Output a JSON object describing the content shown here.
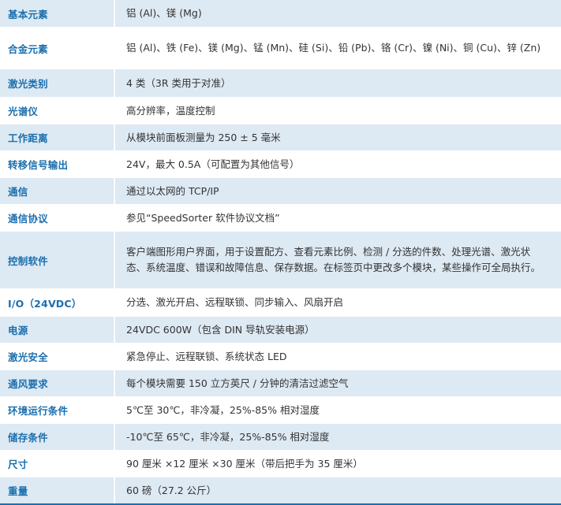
{
  "specs": [
    {
      "label": "基本元素",
      "value": "铝 (Al)、镁 (Mg)"
    },
    {
      "label": "合金元素",
      "value": "铝 (Al)、铁 (Fe)、镁 (Mg)、锰 (Mn)、硅 (Si)、铅 (Pb)、铬 (Cr)、镍 (Ni)、铜 (Cu)、锌 (Zn)"
    },
    {
      "label": "激光类别",
      "value": "4 类（3R 类用于对准）"
    },
    {
      "label": "光谱仪",
      "value": "高分辨率，温度控制"
    },
    {
      "label": "工作距离",
      "value": "从模块前面板测量为 250 ± 5 毫米"
    },
    {
      "label": "转移信号输出",
      "value": "24V，最大 0.5A（可配置为其他信号）"
    },
    {
      "label": "通信",
      "value": "通过以太网的 TCP/IP"
    },
    {
      "label": "通信协议",
      "value": "参见“SpeedSorter 软件协议文档”"
    },
    {
      "label": "控制软件",
      "value": "客户端图形用户界面，用于设置配方、查看元素比例、检测 / 分选的件数、处理光谱、激光状态、系统温度、错误和故障信息、保存数据。在标签页中更改多个模块，某些操作可全局执行。"
    },
    {
      "label": "I/O（24VDC）",
      "value": "分选、激光开启、远程联锁、同步输入、风扇开启"
    },
    {
      "label": "电源",
      "value": "24VDC 600W（包含 DIN 导轨安装电源）"
    },
    {
      "label": "激光安全",
      "value": "紧急停止、远程联锁、系统状态 LED"
    },
    {
      "label": "通风要求",
      "value": "每个模块需要 150 立方英尺 / 分钟的清洁过滤空气"
    },
    {
      "label": "环境运行条件",
      "value": "5℃至 30℃，非冷凝，25%-85% 相对湿度"
    },
    {
      "label": "储存条件",
      "value": "-10℃至 65℃，非冷凝，25%-85% 相对湿度"
    },
    {
      "label": "尺寸",
      "value": "90 厘米 ×12 厘米 ×30 厘米（带后把手为 35 厘米）"
    },
    {
      "label": "重量",
      "value": "60 磅（27.2 公斤）"
    }
  ]
}
